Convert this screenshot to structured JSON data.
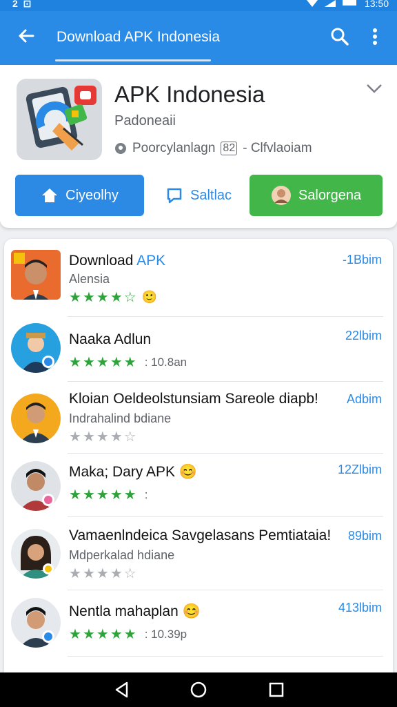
{
  "status_bar": {
    "left": "2 ⊡",
    "time": "13:50"
  },
  "app_bar": {
    "title": "Download APK Indonesia"
  },
  "header": {
    "app_title": "APK Indonesia",
    "subtitle": "Padoneaii",
    "meta_text": "Poorcylanlagn",
    "meta_tag": "82",
    "meta_text2": "- Clfvlaoiam",
    "buttons": [
      {
        "label": "Ciyeolhy",
        "icon": "home-icon"
      },
      {
        "label": "Saltlac",
        "icon": "chat-icon"
      },
      {
        "label": "Salorgena",
        "icon": "avatar-icon"
      }
    ]
  },
  "list": [
    {
      "name_main": "Download ",
      "name_accent": "APK",
      "desc": "Alensia",
      "size": "-1Bbim",
      "stars": 5,
      "rating_text": "",
      "emoji": "🙂"
    },
    {
      "name_main": "Naaka Adlun",
      "name_accent": "",
      "desc": "",
      "size": "22lbim",
      "stars": 5,
      "rating_text": ": 10.8an",
      "emoji": ""
    },
    {
      "name_main": "Kloian Oeldeolstunsiam Sareole diapb!",
      "name_accent": "",
      "desc": "Indrahalind bdiane",
      "size": "Adbim",
      "stars": 5,
      "rating_text": "",
      "emoji": ""
    },
    {
      "name_main": "Maka; Dary APK",
      "name_accent": "",
      "desc": "",
      "size": "12Zlbim",
      "stars": 5,
      "rating_text": ":",
      "emoji": "😊"
    },
    {
      "name_main": "Vamaenlndeica Savgelasans Pemtiataia!",
      "name_accent": "",
      "desc": "Mdperkalad hdiane",
      "size": "89bim",
      "stars": 5,
      "rating_text": "",
      "emoji": ""
    },
    {
      "name_main": "Nentla mahaplan",
      "name_accent": "",
      "desc": "",
      "size": "413lbim",
      "stars": 5,
      "rating_text": ": 10.39p",
      "emoji": "😊"
    }
  ],
  "colors": {
    "primary": "#2a8be6",
    "green": "#43b649",
    "star": "#2fa33b"
  }
}
